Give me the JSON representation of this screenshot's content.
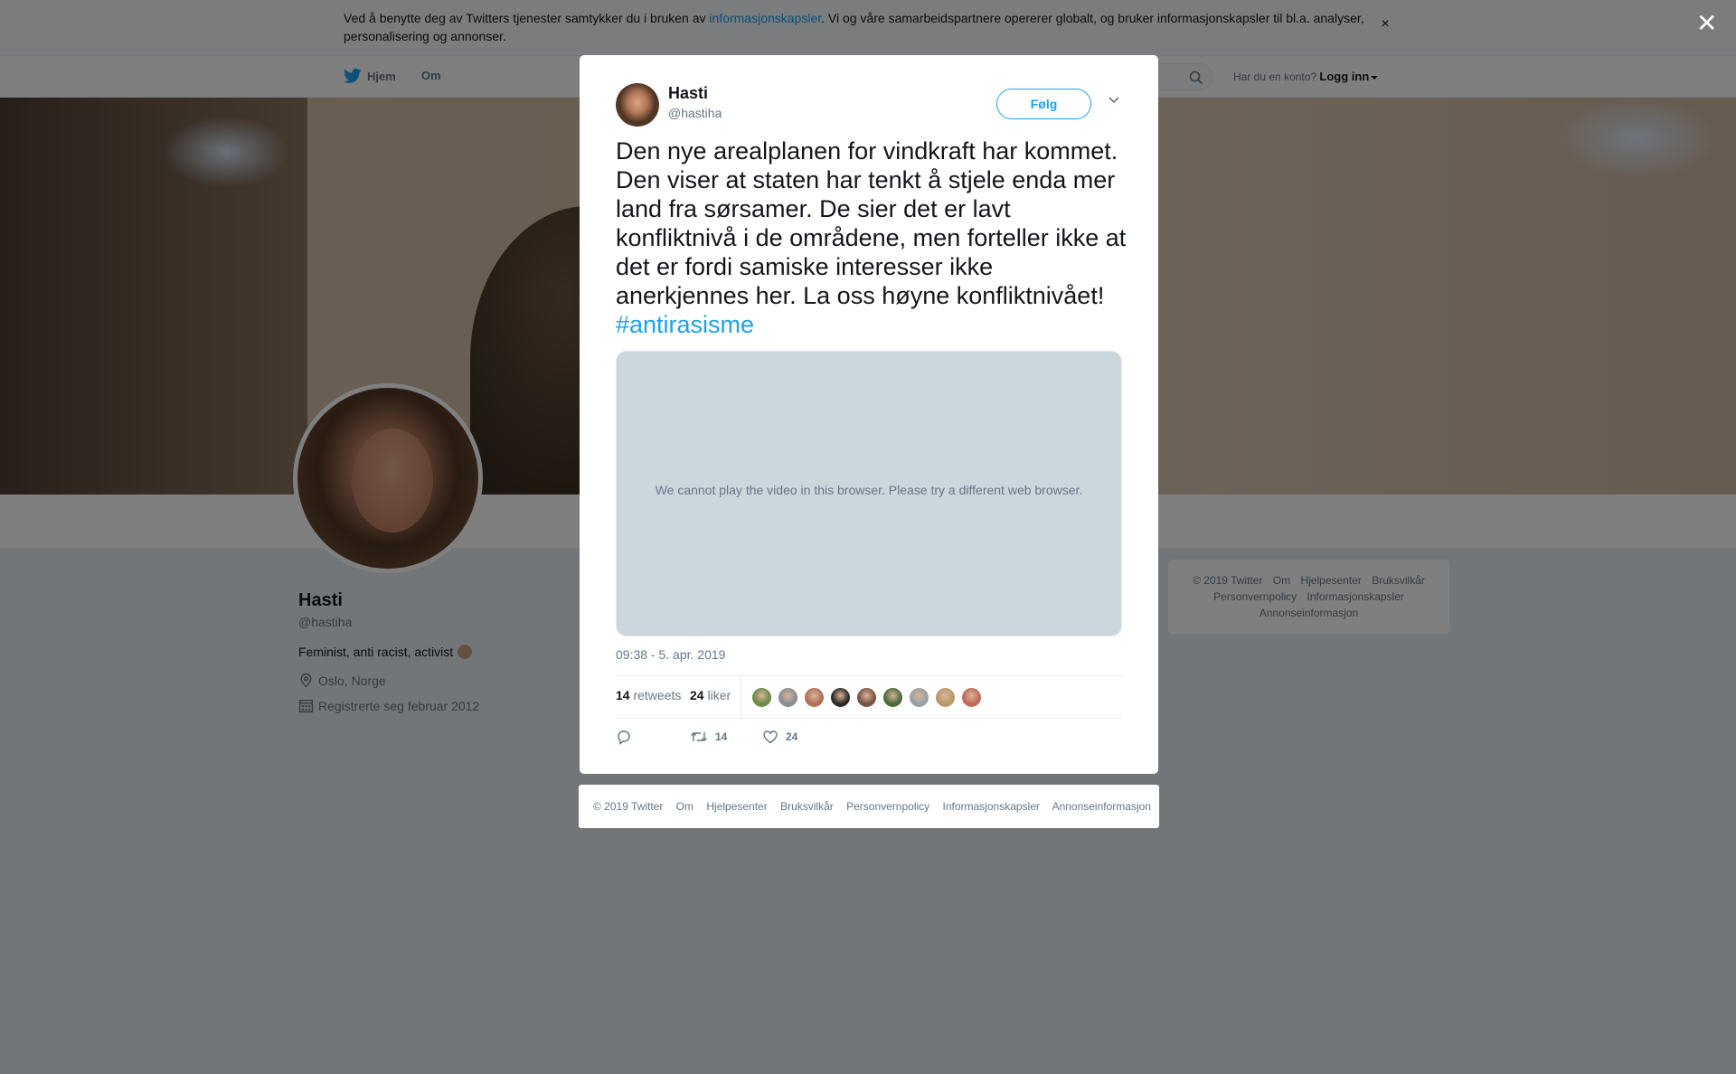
{
  "cookie_banner": {
    "text_before": "Ved å benytte deg av Twitters tjenester samtykker du i bruken av ",
    "link": "informasjonskapsler",
    "text_after": ". Vi og våre samarbeidspartnere opererer globalt, og bruker informasjonskapsler til bl.a. analyser, personalisering og annonser.",
    "close": "×"
  },
  "nav": {
    "home": "Hjem",
    "about": "Om",
    "account_question": "Har du en konto?",
    "login": "Logg inn"
  },
  "profile": {
    "name": "Hasti",
    "handle": "@hastiha",
    "bio": "Feminist, anti racist, activist",
    "location": "Oslo, Norge",
    "joined": "Registrerte seg februar 2012"
  },
  "side_footer": {
    "links": [
      "© 2019 Twitter",
      "Om",
      "Hjelpesenter",
      "Bruksvilkår",
      "Personvernpolicy",
      "Informasjonskapsler",
      "Annonseinformasjon"
    ]
  },
  "overlay": {
    "close": "✕"
  },
  "tweet": {
    "name": "Hasti",
    "handle": "@hastiha",
    "follow": "Følg",
    "text": "Den nye arealplanen for vindkraft har kommet. Den viser at staten har tenkt å stjele enda mer land fra sørsamer. De sier det er lavt konfliktnivå i de områdene, men forteller ikke at det er fordi samiske interesser ikke anerkjennes her. La oss høyne konfliktnivået!",
    "hashtag": "#antirasisme",
    "video_message": "We cannot play the video in this browser. Please try a different web browser.",
    "timestamp": "09:38 - 5. apr. 2019",
    "retweets_count": "14",
    "retweets_label": "retweets",
    "likes_count": "24",
    "likes_label": "liker",
    "action_retweets": "14",
    "action_likes": "24",
    "liker_colors": [
      "#6e8a4a",
      "#8a8f96",
      "#b0705a",
      "#2f2a28",
      "#7a5546",
      "#4d6b3d",
      "#9aa0a6",
      "#b79a6a",
      "#c26a5a"
    ]
  },
  "modal_footer": {
    "links": [
      "© 2019 Twitter",
      "Om",
      "Hjelpesenter",
      "Bruksvilkår",
      "Personvernpolicy",
      "Informasjonskapsler",
      "Annonseinformasjon"
    ]
  }
}
